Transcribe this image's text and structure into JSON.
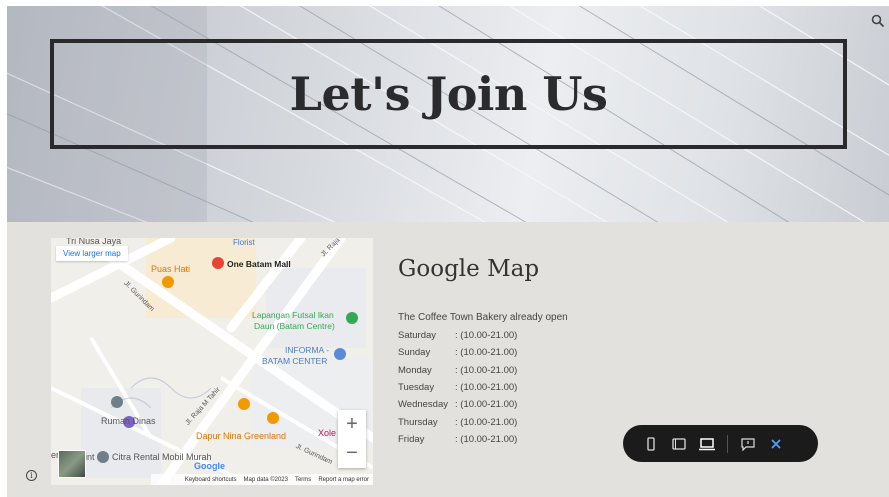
{
  "hero": {
    "title": "Let's Join Us"
  },
  "header": {
    "search_icon": "search-icon"
  },
  "map": {
    "view_larger": "View larger map",
    "labels": {
      "nusa_jaya": "Tri Nusa Jaya",
      "florist": "Florist",
      "jl_raja": "Jl. Raja",
      "puas_hati": "Puas Hati",
      "one_batam_mall": "One Batam Mall",
      "jl_gurindam": "Jl. Gurindam",
      "lapangan_1": "Lapangan Futsal Ikan",
      "lapangan_2": "Daun (Batam Centre)",
      "informa_1": "INFORMA -",
      "informa_2": "BATAM CENTER",
      "jl_raja_m_tahir": "Jl. Raja M Tahir",
      "rumah_dinas": "Rumah Dinas",
      "dapur_nina": "Dapur Nina Greenland",
      "xole": "Xole",
      "citra_rental": "Citra Rental Mobil Murah",
      "jl_gurindam_2": "Jl. Gurindam",
      "google": "Google",
      "eri": "eri",
      "int": "int"
    },
    "zoom_in": "+",
    "zoom_out": "−",
    "footer": {
      "shortcuts": "Keyboard shortcuts",
      "map_data": "Map data ©2023",
      "terms": "Terms",
      "report": "Report a map error"
    }
  },
  "info": {
    "heading": "Google Map",
    "intro": "The Coffee Town Bakery already open",
    "hours": [
      {
        "day": "Saturday",
        "time": ": (10.00-21.00)"
      },
      {
        "day": "Sunday",
        "time": ": (10.00-21.00)"
      },
      {
        "day": "Monday",
        "time": ": (10.00-21.00)"
      },
      {
        "day": "Tuesday",
        "time": ": (10.00-21.00)"
      },
      {
        "day": "Wednesday",
        "time": ": (10.00-21.00)"
      },
      {
        "day": "Thursday",
        "time": ": (10.00-21.00)"
      },
      {
        "day": "Friday",
        "time": ": (10.00-21.00)"
      }
    ]
  },
  "toolbar": {
    "items": [
      "phone-icon",
      "tablet-icon",
      "laptop-icon",
      "feedback-icon",
      "close-icon"
    ],
    "accent": "#4ea3ff"
  },
  "footer_icon": "info-icon"
}
